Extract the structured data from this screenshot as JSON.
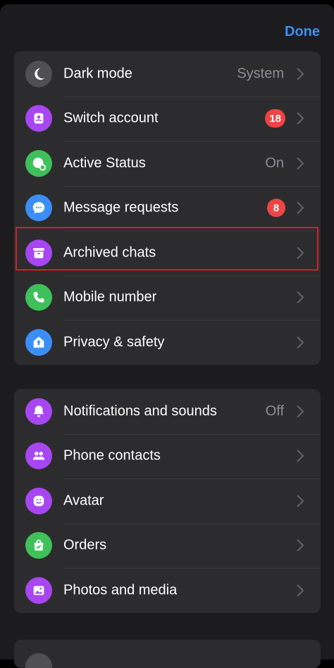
{
  "header": {
    "done_label": "Done"
  },
  "group1": [
    {
      "label": "Dark mode",
      "value": "System",
      "icon": "moon-icon",
      "color": "#505052"
    },
    {
      "label": "Switch account",
      "badge": "18",
      "icon": "switch-account-icon",
      "color": "#a846f2"
    },
    {
      "label": "Active Status",
      "value": "On",
      "icon": "active-status-icon",
      "color": "#3fc05a"
    },
    {
      "label": "Message requests",
      "badge": "8",
      "icon": "chat-bubble-icon",
      "color": "#3b8ef5"
    },
    {
      "label": "Archived chats",
      "icon": "archive-box-icon",
      "color": "#a846f2"
    },
    {
      "label": "Mobile number",
      "icon": "phone-icon",
      "color": "#3fc05a"
    },
    {
      "label": "Privacy & safety",
      "icon": "shield-house-icon",
      "color": "#3b8ef5"
    }
  ],
  "group2": [
    {
      "label": "Notifications and sounds",
      "value": "Off",
      "icon": "bell-icon",
      "color": "#a846f2"
    },
    {
      "label": "Phone contacts",
      "icon": "people-icon",
      "color": "#a846f2"
    },
    {
      "label": "Avatar",
      "icon": "avatar-icon",
      "color": "#a846f2"
    },
    {
      "label": "Orders",
      "icon": "shopping-bag-icon",
      "color": "#3fc05a"
    },
    {
      "label": "Photos and media",
      "icon": "photo-icon",
      "color": "#a846f2"
    }
  ]
}
